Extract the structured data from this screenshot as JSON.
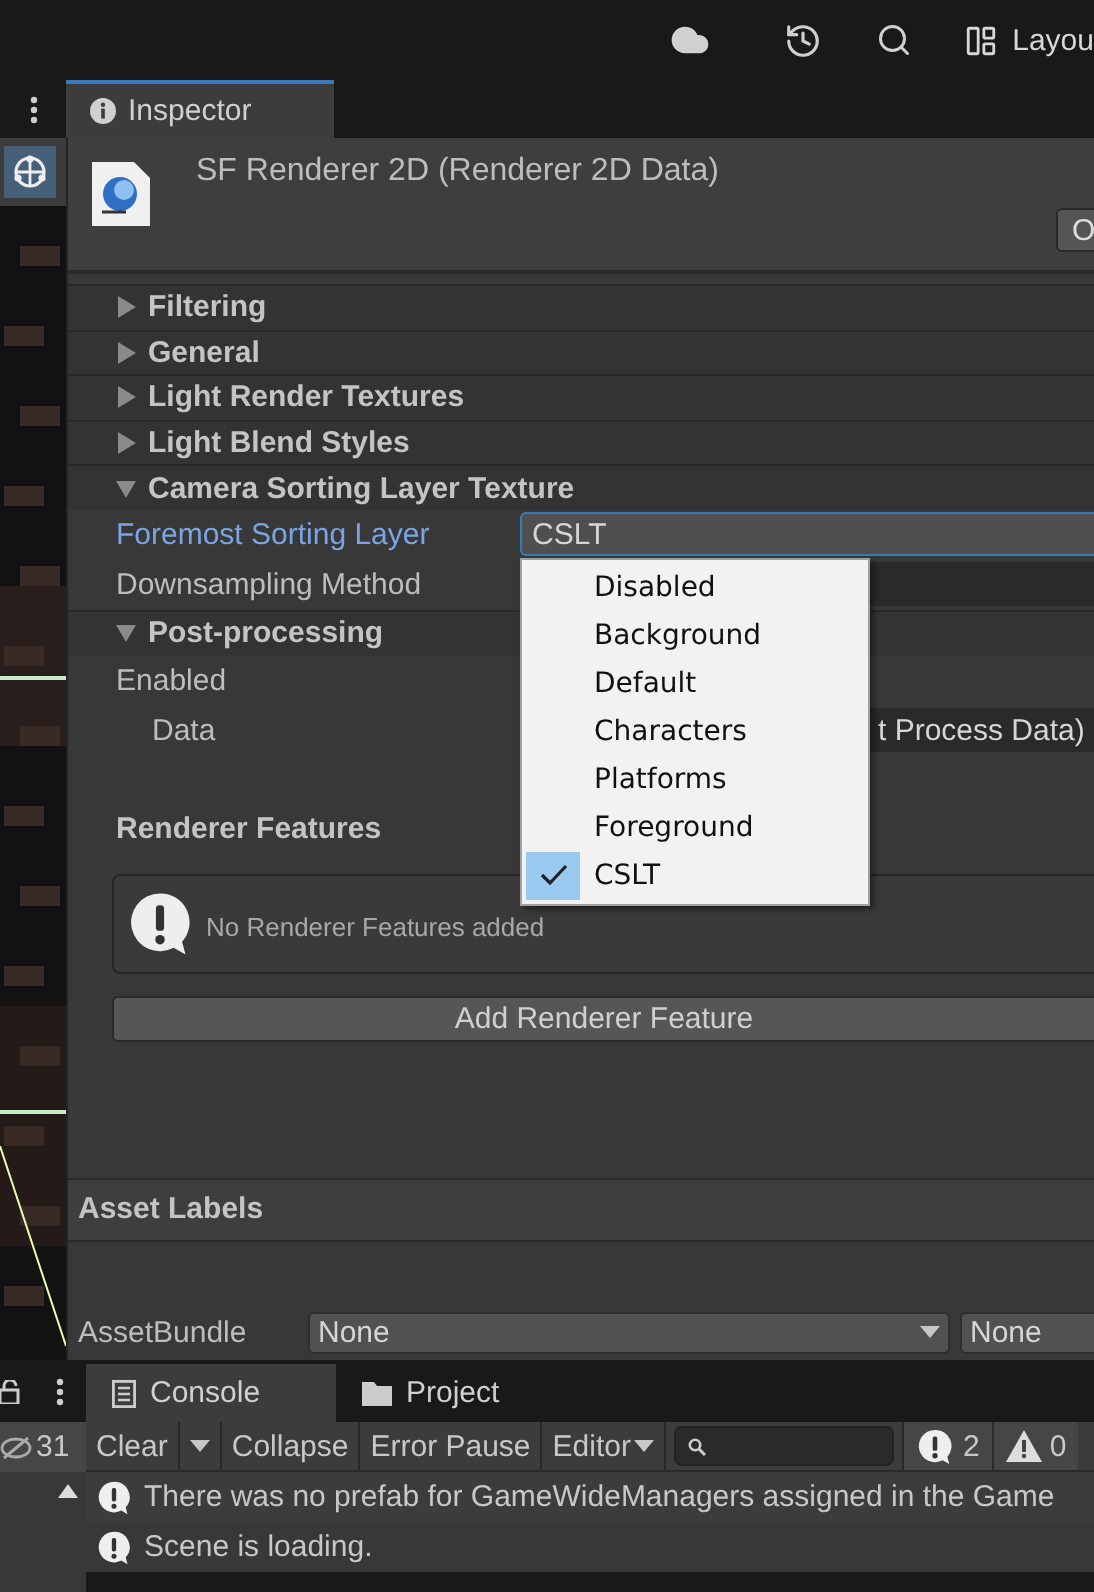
{
  "toolbar": {
    "layout_label": "Layou"
  },
  "scene_strip": {
    "hidden_count": "31"
  },
  "inspector": {
    "tab": "Inspector",
    "title": "SF Renderer 2D (Renderer 2D Data)",
    "open_button": "O",
    "sections": [
      {
        "label": "Filtering",
        "expanded": false
      },
      {
        "label": "General",
        "expanded": false
      },
      {
        "label": "Light Render Textures",
        "expanded": false
      },
      {
        "label": "Light Blend Styles",
        "expanded": false
      },
      {
        "label": "Camera Sorting Layer Texture",
        "expanded": true,
        "fields": [
          {
            "label": "Foremost Sorting Layer",
            "kind": "dropdown",
            "value": "CSLT",
            "focused": true,
            "menu": [
              {
                "label": "Disabled",
                "selected": false
              },
              {
                "label": "Background",
                "selected": false
              },
              {
                "label": "Default",
                "selected": false
              },
              {
                "label": "Characters",
                "selected": false
              },
              {
                "label": "Platforms",
                "selected": false
              },
              {
                "label": "Foreground",
                "selected": false
              },
              {
                "label": "CSLT",
                "selected": true
              }
            ]
          },
          {
            "label": "Downsampling Method",
            "kind": "dropdown",
            "focused": false
          }
        ]
      },
      {
        "label": "Post-processing",
        "expanded": true,
        "fields": [
          {
            "label": "Enabled",
            "kind": "plain",
            "focused": false
          },
          {
            "label": "Data",
            "kind": "object",
            "value": "t Process Data)",
            "focused": false,
            "indented": true
          }
        ]
      }
    ],
    "renderer_features": {
      "heading": "Renderer Features",
      "empty_message": "No Renderer Features added",
      "add_button": "Add Renderer Feature"
    },
    "asset_labels": {
      "heading": "Asset Labels",
      "bundle_label": "AssetBundle",
      "bundle_value": "None",
      "variant_value": "None"
    }
  },
  "console": {
    "tabs": [
      {
        "label": "Console",
        "selected": true
      },
      {
        "label": "Project",
        "selected": false
      }
    ],
    "buttons": {
      "clear": "Clear",
      "collapse": "Collapse",
      "error_pause": "Error Pause",
      "editor": "Editor"
    },
    "error_count": "2",
    "warning_count": "0",
    "messages": [
      "There was no prefab for GameWideManagers assigned in the Game",
      "Scene is loading."
    ]
  }
}
